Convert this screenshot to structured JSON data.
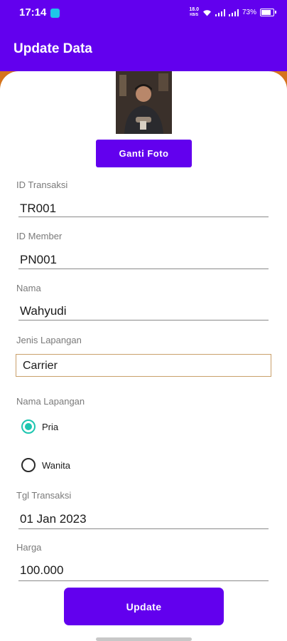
{
  "status_bar": {
    "time": "17:14",
    "net_speed_value": "18.0",
    "net_speed_unit": "KB/S",
    "battery": "73%"
  },
  "app_bar": {
    "title": "Update Data"
  },
  "photo": {
    "change_button": "Ganti Foto"
  },
  "form": {
    "id_transaksi": {
      "label": "ID Transaksi",
      "value": "TR001"
    },
    "id_member": {
      "label": "ID Member",
      "value": "PN001"
    },
    "nama": {
      "label": "Nama",
      "value": "Wahyudi"
    },
    "jenis_lapangan": {
      "label": "Jenis Lapangan",
      "value": "Carrier"
    },
    "nama_lapangan": {
      "label": "Nama Lapangan",
      "options": [
        "Pria",
        "Wanita"
      ],
      "selected": "Pria"
    },
    "tgl_transaksi": {
      "label": "Tgl Transaksi",
      "value": "01 Jan 2023"
    },
    "harga": {
      "label": "Harga",
      "value": "100.000"
    }
  },
  "actions": {
    "update_label": "Update"
  },
  "colors": {
    "primary": "#6200ee",
    "accent": "#1ec6b0",
    "card_background": "#d5741c"
  }
}
